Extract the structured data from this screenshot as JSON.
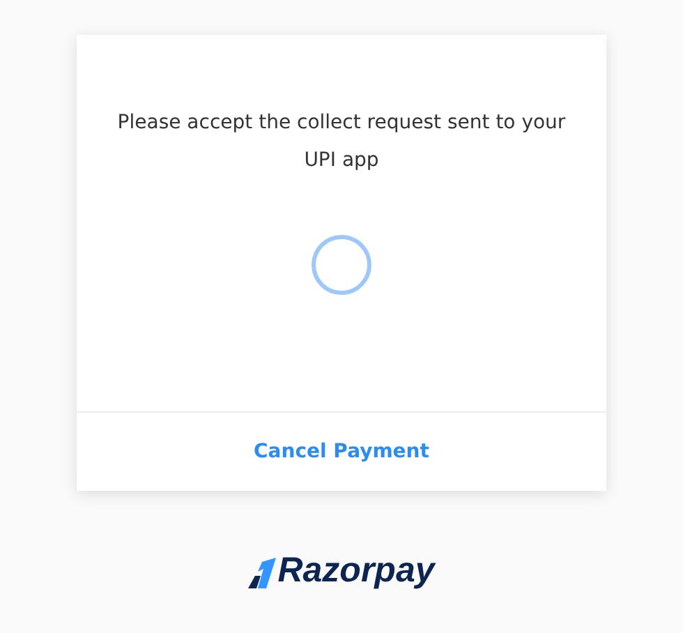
{
  "card": {
    "message": "Please accept the collect request sent to your UPI app",
    "cancel_button": "Cancel Payment"
  },
  "brand": {
    "name": "Razorpay"
  }
}
